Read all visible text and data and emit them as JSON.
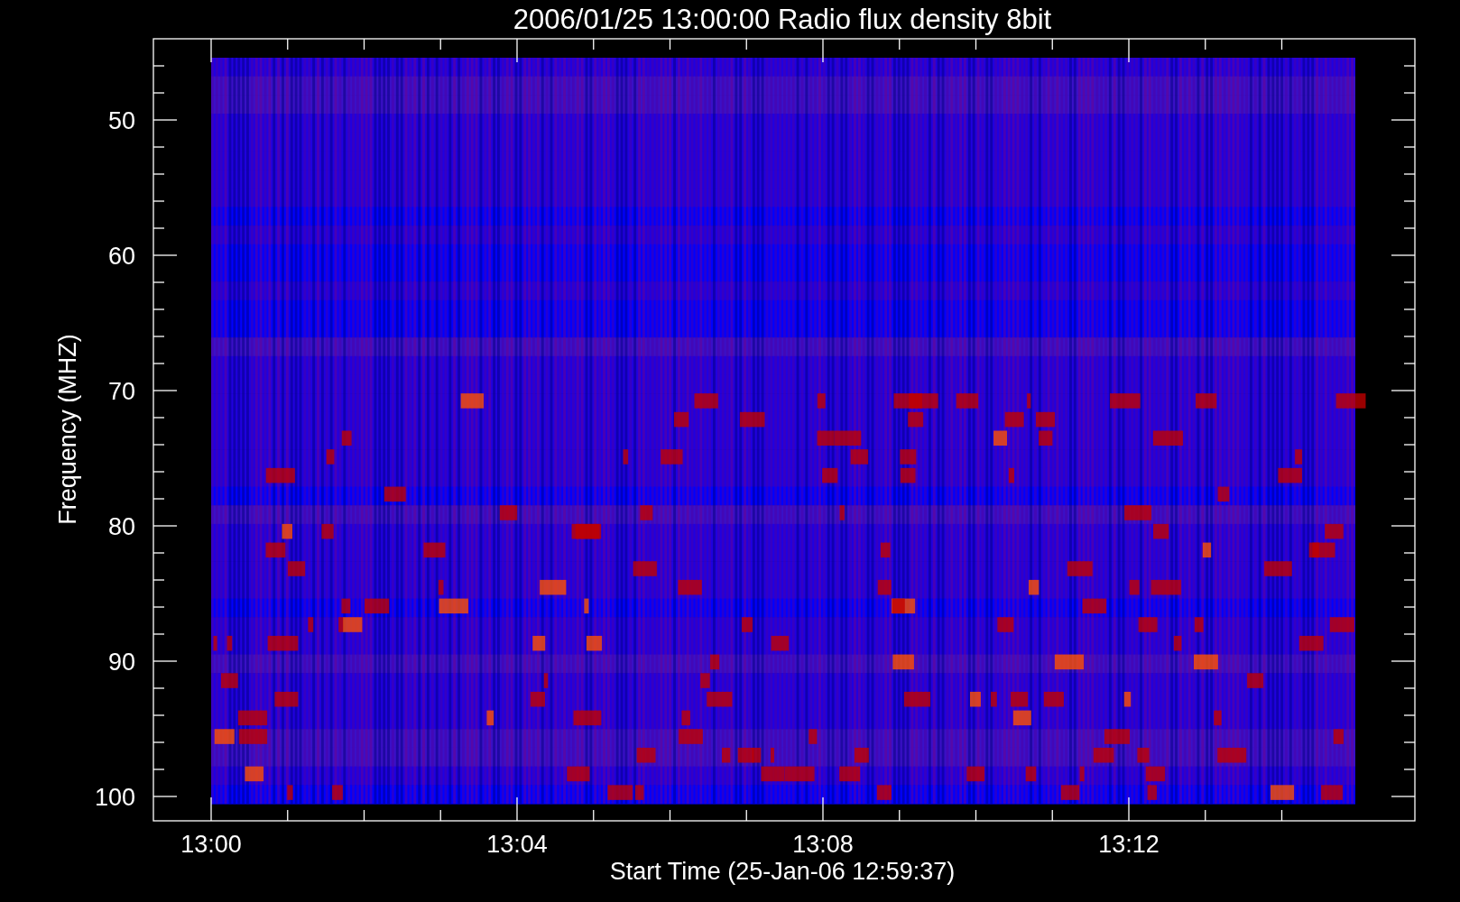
{
  "title": "2006/01/25 13:00:00 Radio flux density 8bit",
  "y_axis": {
    "label": "Frequency (MHZ)",
    "tick_labels": [
      "50",
      "60",
      "70",
      "80",
      "90",
      "100"
    ]
  },
  "x_axis": {
    "label": "Start Time (25-Jan-06 12:59:37)",
    "tick_labels": [
      "13:00",
      "13:04",
      "13:08",
      "13:12"
    ]
  }
}
